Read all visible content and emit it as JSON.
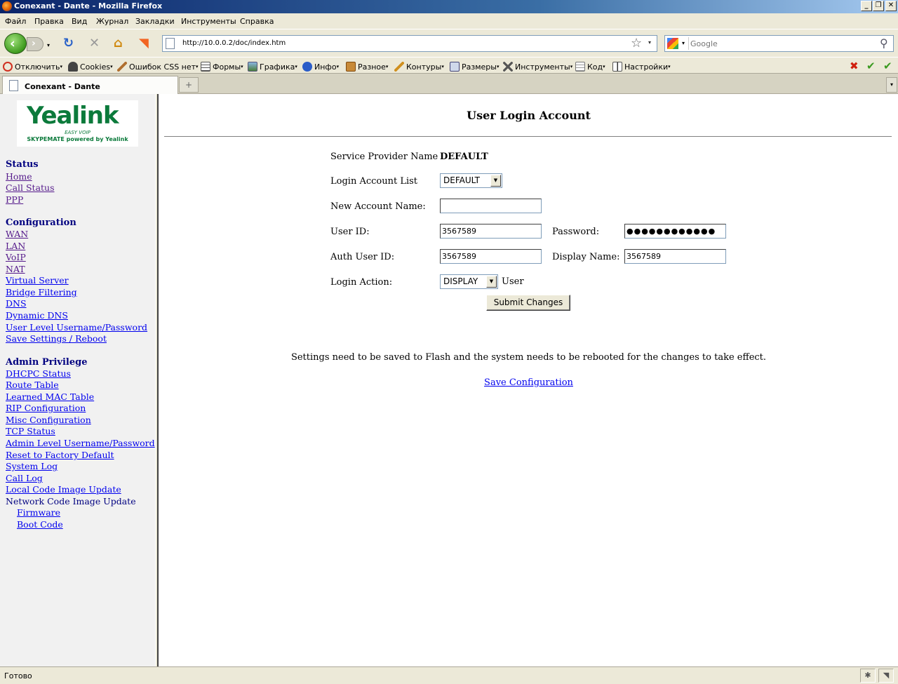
{
  "window": {
    "title": "Conexant - Dante - Mozilla Firefox",
    "btn_minimize": "_",
    "btn_restore": "❐",
    "btn_close": "✕"
  },
  "menu": [
    "Файл",
    "Правка",
    "Вид",
    "Журнал",
    "Закладки",
    "Инструменты",
    "Справка"
  ],
  "navbar": {
    "url": "http://10.0.0.2/doc/index.htm",
    "search_placeholder": "Google",
    "back_glyph": "‹",
    "fwd_glyph": "›",
    "reload_glyph": "↻",
    "stop_glyph": "✕",
    "home_glyph": "⌂",
    "rss_glyph": "◥",
    "star_glyph": "☆",
    "dropdown_glyph": "▾",
    "search_glyph": "⚲"
  },
  "devbar": {
    "items": [
      "Отключить",
      "Cookies",
      "Ошибок CSS нет",
      "Формы",
      "Графика",
      "Инфо",
      "Разное",
      "Контуры",
      "Размеры",
      "Инструменты",
      "Код",
      "Настройки"
    ],
    "arrow": "▾",
    "error_glyph": "✖",
    "check_glyph": "✔"
  },
  "tabs": {
    "active_label": "Conexant - Dante",
    "newtab_glyph": "+",
    "menu_glyph": "▾"
  },
  "sidebar": {
    "logo_brand": "Yealink",
    "logo_tag": "EASY VOIP",
    "logo_sub": "SKYPEMATE powered by Yealink",
    "sections": [
      {
        "title": "Status",
        "links": [
          "Home",
          "Call Status",
          "PPP"
        ]
      },
      {
        "title": "Configuration",
        "links": [
          "WAN",
          "LAN",
          "VoIP",
          "NAT",
          "Virtual Server",
          "Bridge Filtering",
          "DNS",
          "Dynamic DNS",
          "User Level Username/Password",
          "Save Settings / Reboot"
        ]
      },
      {
        "title": "Admin Privilege",
        "links": [
          "DHCPC Status",
          "Route Table",
          "Learned MAC Table",
          "RIP Configuration",
          "Misc Configuration",
          "TCP Status",
          "Admin Level Username/Password",
          "Reset to Factory Default",
          "System Log",
          "Call Log",
          "Local Code Image Update"
        ],
        "text_item": "Network Code Image Update",
        "sub_links": [
          "Firmware",
          "Boot Code"
        ]
      }
    ]
  },
  "main": {
    "title": "User Login Account",
    "service_provider_label": "Service Provider Name",
    "service_provider_value": "DEFAULT",
    "login_account_list_label": "Login Account List",
    "login_account_list_value": "DEFAULT",
    "new_account_name_label": "New Account Name:",
    "new_account_name_value": "",
    "user_id_label": "User ID:",
    "user_id_value": "3567589",
    "password_label": "Password:",
    "password_value": "●●●●●●●●●●●●",
    "auth_user_id_label": "Auth User ID:",
    "auth_user_id_value": "3567589",
    "display_name_label": "Display Name:",
    "display_name_value": "3567589",
    "login_action_label": "Login Action:",
    "login_action_value": "DISPLAY",
    "login_action_suffix": "User",
    "submit_label": "Submit Changes",
    "note": "Settings need to be saved to Flash and the system needs to be rebooted for the changes to take effect.",
    "save_link": "Save Configuration",
    "select_arrow": "▼"
  },
  "status": {
    "text": "Готово"
  }
}
